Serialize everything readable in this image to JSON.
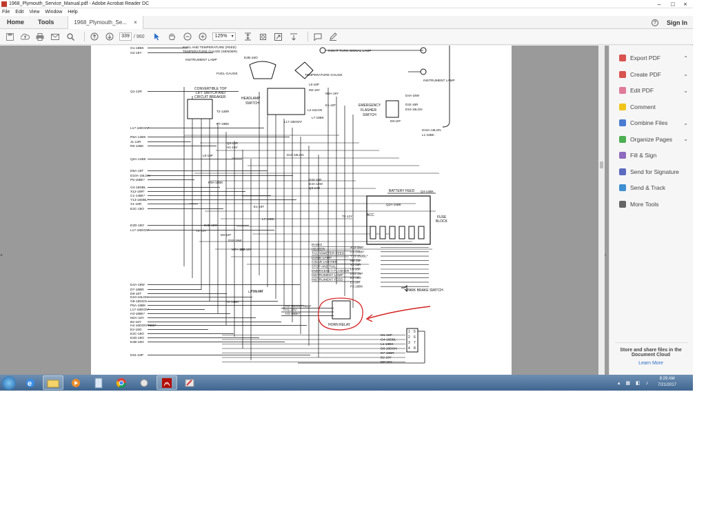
{
  "window": {
    "title": "1968_Plymouth_Service_Manual.pdf - Adobe Acrobat Reader DC",
    "controls": {
      "minimize": "–",
      "maximize": "□",
      "close": "×"
    }
  },
  "menu": [
    "File",
    "Edit",
    "View",
    "Window",
    "Help"
  ],
  "tabs": {
    "home": "Home",
    "tools": "Tools",
    "document": "1968_Plymouth_Se...",
    "close": "×",
    "signin": "Sign In",
    "help": "?"
  },
  "toolbar": {
    "page_current": "339",
    "page_total": "/ 960",
    "zoom": "125%"
  },
  "right_panel": {
    "items": [
      {
        "label": "Export PDF",
        "color": "#d9534f",
        "chev": "^"
      },
      {
        "label": "Create PDF",
        "color": "#d9534f",
        "chev": "v"
      },
      {
        "label": "Edit PDF",
        "color": "#e07b9a",
        "chev": "v"
      },
      {
        "label": "Comment",
        "color": "#f0c419",
        "chev": ""
      },
      {
        "label": "Combine Files",
        "color": "#4a7bd1",
        "chev": "v"
      },
      {
        "label": "Organize Pages",
        "color": "#4caf50",
        "chev": "v"
      },
      {
        "label": "Fill & Sign",
        "color": "#8e6bbf",
        "chev": ""
      },
      {
        "label": "Send for Signature",
        "color": "#5c6bc0",
        "chev": ""
      },
      {
        "label": "Send & Track",
        "color": "#3f8fd2",
        "chev": ""
      },
      {
        "label": "More Tools",
        "color": "#666666",
        "chev": ""
      }
    ],
    "cloud_text": "Store and share files in the Document Cloud",
    "learn_more": "Learn More"
  },
  "taskbar": {
    "time": "8:29 AM",
    "date": "7/21/2017"
  },
  "diagram": {
    "labels_left": [
      "G1-18BK",
      "G2-18Y",
      "Q1-12R",
      "L17-18DGN*",
      "R6A-12BK",
      "J1-12R",
      "R6-12BK",
      "Q2A-14BK",
      "D9A-18T",
      "D10A-18LGN",
      "P5-18BK*",
      "G4-18DBL",
      "X12-18R*",
      "C1-14BK*",
      "Y13-18DBL*",
      "X1-16R",
      "E2C-18O",
      "E2D-18O",
      "L17-18DGN*",
      "D4A-18W",
      "D7-18BR",
      "D8-18T",
      "D10-18LGN",
      "G8-18DGN",
      "P5A-18BK",
      "L17-18DGN*",
      "H3-18BK*",
      "M2A-18Y",
      "B2-18Y",
      "H2-16DGN*RED*",
      "E2-18O",
      "E2C-18O",
      "E2D-18O",
      "E2B-18O",
      "D31-18P"
    ],
    "top_labels": [
      "FUEL AND TEMPERATURE (FEED)",
      "TEMPERATURE GAUGE (SENDER)",
      "INSTRUMENT LAMP",
      "E2B-18O",
      "FUEL GAUGE",
      "TEMPERATURE GAUGE",
      "RIGHT TURN SIGNAL LAMP",
      "INSTRUMENT LAMP"
    ],
    "components": [
      "CONVERTIBLE TOP",
      "LIFT SWITCH AND",
      "CIRCUIT BREAKER",
      "HEADLAMP",
      "SWITCH",
      "EMERGENCY",
      "FLASHER",
      "SWITCH",
      "FUSE",
      "BLOCK",
      "BATTERY FEED",
      "ACC",
      "HORN RELAY",
      "PARK BRAKE SWITCH"
    ],
    "mid_labels": [
      "L8-18P",
      "M2-18Y",
      "M2A-18Y",
      "E1-18T",
      "L2-16LGN",
      "L7-18BK",
      "L17-18DGN*",
      "D4A-18W",
      "D32-18R",
      "D10-18LGN",
      "D9-18T",
      "D10A-18LGN",
      "L1-16BK",
      "Q3-14R",
      "H1-16V",
      "L8-18P",
      "D10-18LGN",
      "D32-18R",
      "D4A-18W",
      "Q3-14R",
      "Q4-14BK",
      "Q2A-14BK",
      "T2-12Y",
      "T2-12BR",
      "P7-18BK",
      "P5A-18BK",
      "E2B-18O",
      "T3-12Y",
      "D9-18T",
      "D32-18W",
      "M7A-18Y",
      "M2-18Y",
      "E1-18T",
      "L7-18BK",
      "L2-16LGN",
      "P7A-18T",
      "T2-12BR"
    ],
    "feed_list": [
      "RADIO",
      "HEATER",
      "TACHOMETER FEED",
      "DOME LAMP",
      "CIGAR LIGHTER",
      "STOP AND TAIL",
      "EMERGENCY FLASHER",
      "INSTRUMENT LAMP",
      "INSTRUMENT FEED"
    ],
    "feed_wires": [
      "X12-18R*",
      "C1-14BK*",
      "Y13-18DBL*",
      "M2-18P",
      "X1-16R",
      "L8-18P",
      "D31-18P",
      "E2-18O",
      "E1-18T",
      "P2-18BK"
    ],
    "horn_wires": [
      "H2-16DGN*RED*",
      "H1-16V",
      "H3-18BK*"
    ],
    "connector_wires": [
      "M1-18P",
      "G4-18DBL",
      "L1-18BK",
      "D8-18DGN",
      "D7-18BR",
      "B2-18Y",
      "M2-18Y"
    ],
    "connector_pins": [
      "1",
      "2",
      "3",
      "4",
      "5",
      "6",
      "7",
      "8"
    ]
  }
}
